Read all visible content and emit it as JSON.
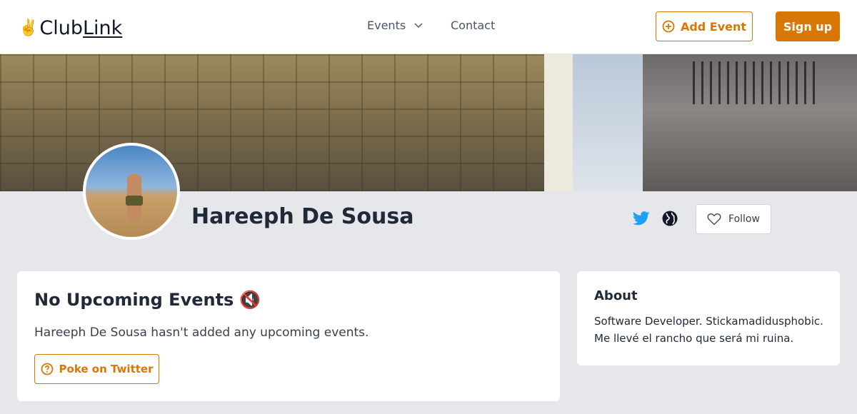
{
  "nav": {
    "logo_text_a": "Club",
    "logo_text_b": "Link",
    "logo_emoji": "✌️",
    "events_label": "Events",
    "contact_label": "Contact",
    "add_event_label": "Add Event",
    "signup_label": "Sign up"
  },
  "profile": {
    "name": "Hareeph De Sousa",
    "follow_label": "Follow"
  },
  "events": {
    "title": "No Upcoming Events",
    "title_emoji": "🔇",
    "description": "Hareeph De Sousa hasn't added any upcoming events.",
    "poke_label": "Poke on Twitter"
  },
  "about": {
    "heading": "About",
    "text": "Software Developer. Stickamadidusphobic. Me llevé el rancho que será mi ruina."
  },
  "colors": {
    "accent": "#d97706",
    "twitter": "#1da1f2",
    "background": "#e5e7eb"
  },
  "icons": [
    "chevron-down-icon",
    "plus-circle-icon",
    "twitter-icon",
    "globe-icon",
    "heart-icon",
    "question-circle-icon"
  ]
}
